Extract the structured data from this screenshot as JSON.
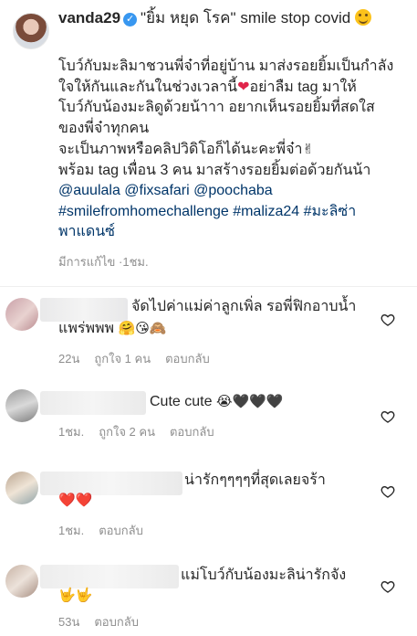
{
  "caption": {
    "username": "vanda29",
    "title_quote": "\"ยิ้ม หยุด โรค\"",
    "title_tail": "smile stop covid",
    "lines": [
      "โบว์กับมะลิมาชวนพี่จ๋าที่อยู่บ้าน มาส่งรอยยิ้มเป็นกำลัง",
      "ใจให้กันและกันในช่วงเวลานี้",
      "อย่าลืม tag มาให้",
      "โบว์กับน้องมะลิดูด้วยน้าาา อยากเห็นรอยยิ้มที่สดใส",
      "ของพี่จ๋าทุกคน",
      "จะเป็นภาพหรือคลิปวิดิโอก็ได้นะคะพี่จ๋า",
      "พร้อม tag เพื่อน 3 คน มาสร้างรอยยิ้มต่อด้วยกันน้า"
    ],
    "mentions": [
      "@auulala",
      "@fixsafari",
      "@poochaba"
    ],
    "hashtags_line1": "#smilefromhomechallenge #maliza24 #มะลิซ่า",
    "hashtags_line2": "พาแดนซ์",
    "edited_label": "มีการแก้ไข",
    "time": "1ชม."
  },
  "comments": [
    {
      "text_line1": "จัดไปค่าแม่ค่าลูกเพิ่ล รอพี่ฟิกอาบน้ำ",
      "text_line2": "แพร่พพพ",
      "emoji": "🤗😘🙈",
      "time": "22น",
      "likes": "ถูกใจ 1 คน",
      "reply": "ตอบกลับ"
    },
    {
      "text_line1": "Cute cute",
      "emoji": "😭🖤🖤🖤",
      "time": "1ชม.",
      "likes": "ถูกใจ 2 คน",
      "reply": "ตอบกลับ"
    },
    {
      "text_line1": "น่ารักๆๆๆๆที่สุดเลยจร้า",
      "emoji": "❤️❤️",
      "time": "1ชม.",
      "reply": "ตอบกลับ"
    },
    {
      "text_line1": "แม่โบว์กับน้องมะลิน่ารักจัง",
      "emoji": "🤟🤟",
      "time": "53น",
      "reply": "ตอบกลับ"
    }
  ],
  "colors": {
    "link": "#003569",
    "meta": "#8e8e8e",
    "verified": "#3897f0",
    "heart": "#e0244a"
  },
  "icons": [
    "verified-badge-icon",
    "like-heart-icon"
  ]
}
